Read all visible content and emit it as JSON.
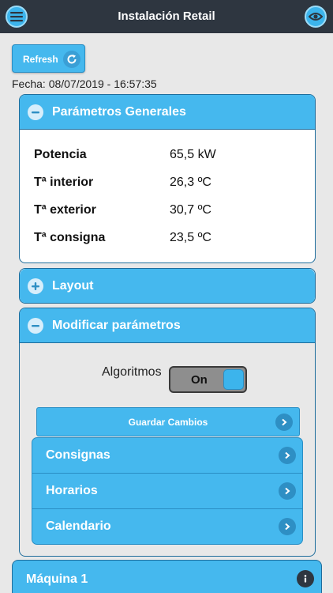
{
  "header": {
    "title": "Instalación Retail",
    "menu_icon": "menu-icon",
    "eye_icon": "eye-icon"
  },
  "toolbar": {
    "refresh_label": "Refresh",
    "refresh_icon": "refresh-icon",
    "fecha": "Fecha: 08/07/2019 - 16:57:35"
  },
  "parametros": {
    "title": "Parámetros Generales",
    "rows": [
      {
        "label": "Potencia",
        "value": "65,5 kW"
      },
      {
        "label": "Tª interior",
        "value": "26,3 ºC"
      },
      {
        "label": "Tª exterior",
        "value": "30,7 ºC"
      },
      {
        "label": "Tª consigna",
        "value": "23,5 ºC"
      }
    ]
  },
  "layout": {
    "title": "Layout"
  },
  "modificar": {
    "title": "Modificar parámetros",
    "algoritmos_label": "Algoritmos",
    "switch_state": "On",
    "guardar_label": "Guardar Cambios",
    "items": [
      {
        "label": "Consignas"
      },
      {
        "label": "Horarios"
      },
      {
        "label": "Calendario"
      }
    ]
  },
  "maquina": {
    "title": "Máquina 1"
  },
  "colors": {
    "header_bg": "#2e3640",
    "accent": "#45b8ee",
    "border": "#1e6d9c",
    "background": "#e8e8e8"
  }
}
